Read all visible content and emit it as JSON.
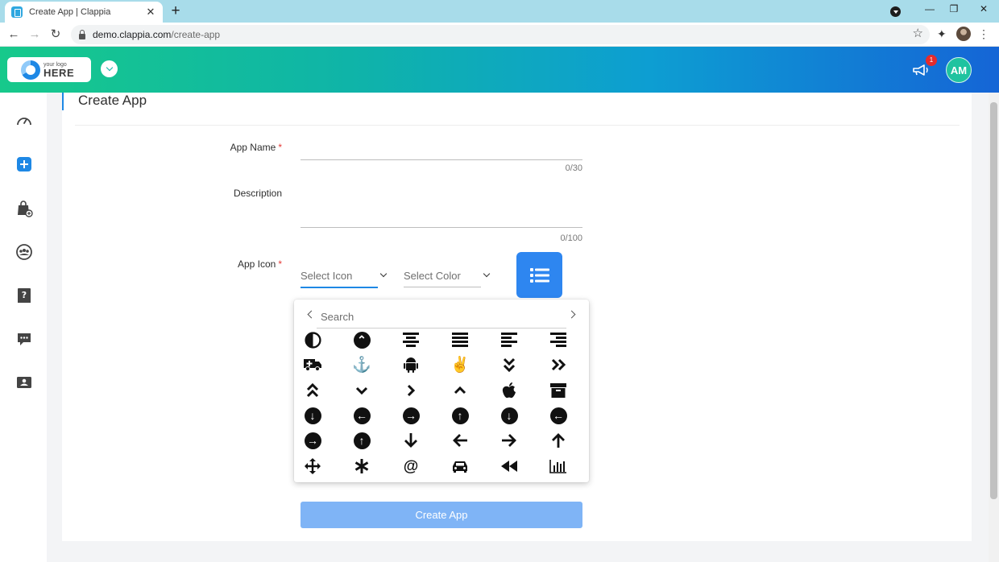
{
  "browser": {
    "tab_title": "Create App | Clappia",
    "tab_close": "✕",
    "new_tab": "+",
    "url_domain": "demo.clappia.com",
    "url_path": "/create-app",
    "controls": {
      "minimize": "—",
      "restore": "❐",
      "close": "✕"
    }
  },
  "header": {
    "logo_small": "your logo",
    "logo_big": "HERE",
    "notification_count": "1",
    "avatar_initials": "AM"
  },
  "sidebar": {
    "items": [
      "dashboard-icon",
      "create-icon",
      "apps-icon",
      "users-icon",
      "help-icon",
      "chat-icon",
      "id-card-icon"
    ]
  },
  "page": {
    "title": "Create App"
  },
  "form": {
    "app_name_label": "App Name",
    "app_name_counter": "0/30",
    "description_label": "Description",
    "description_counter": "0/100",
    "app_icon_label": "App Icon",
    "required_mark": "*",
    "select_icon": "Select Icon",
    "select_color": "Select Color",
    "preview_icon": "list-icon",
    "preview_color": "#2e86f0"
  },
  "picker": {
    "search_placeholder": "Search",
    "icons": [
      "adjust",
      "angle-up-circle",
      "align-center",
      "align-justify",
      "align-left",
      "align-right",
      "ambulance",
      "anchor",
      "android",
      "peace-hand",
      "angle-double-down",
      "angle-double-right",
      "angle-double-up",
      "angle-down",
      "angle-right",
      "angle-up",
      "apple",
      "archive",
      "arrow-circle-down",
      "arrow-circle-left",
      "arrow-circle-right",
      "arrow-circle-up",
      "arrow-circle-down-alt",
      "arrow-circle-left-alt",
      "arrow-circle-right-alt",
      "arrow-circle-up-alt",
      "arrow-down",
      "arrow-left",
      "arrow-right",
      "arrow-up",
      "arrows-move",
      "asterisk",
      "at",
      "car",
      "backward",
      "bar-chart"
    ]
  },
  "actions": {
    "create_app": "Create App"
  },
  "colors": {
    "header_start": "#17c98b",
    "header_end": "#1565d6",
    "primary": "#2e86f0",
    "button_disabled": "#7fb4f6",
    "badge": "#e52b2b"
  }
}
